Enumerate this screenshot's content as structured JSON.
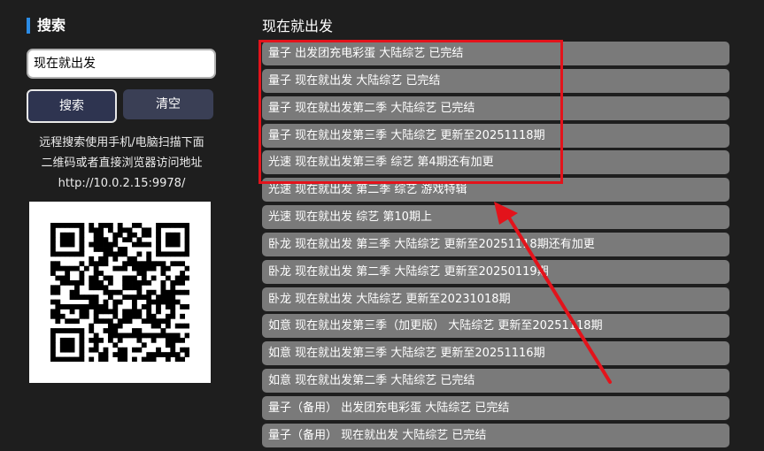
{
  "sidebar": {
    "title": "搜索",
    "search_value": "现在就出发",
    "search_button": "搜索",
    "clear_button": "清空",
    "hint_lines": [
      "远程搜索使用手机/电脑扫描下面",
      "二维码或者直接浏览器访问地址",
      "http://10.0.2.15:9978/"
    ]
  },
  "results": {
    "title": "现在就出发",
    "items": [
      "量子 出发团充电彩蛋 大陆综艺 已完结",
      "量子 现在就出发 大陆综艺 已完结",
      "量子 现在就出发第二季 大陆综艺 已完结",
      "量子 现在就出发第三季 大陆综艺 更新至20251118期",
      "光速 现在就出发第三季 综艺 第4期还有加更",
      "光速 现在就出发 第二季 综艺 游戏特辑",
      "光速 现在就出发 综艺 第10期上",
      "卧龙 现在就出发 第三季 大陆综艺 更新至20251118期还有加更",
      "卧龙 现在就出发 第二季 大陆综艺 更新至20250119期",
      "卧龙 现在就出发 大陆综艺 更新至20231018期",
      "如意 现在就出发第三季（加更版） 大陆综艺 更新至20251118期",
      "如意 现在就出发第三季 大陆综艺 更新至20251116期",
      "如意 现在就出发第二季 大陆综艺 已完结",
      "量子（备用） 出发团充电彩蛋 大陆综艺 已完结",
      "量子（备用） 现在就出发 大陆综艺 已完结"
    ]
  },
  "colors": {
    "accent": "#2b8ce6",
    "highlight": "#e3131b",
    "row_bg": "#7a7a7a",
    "bg": "#1e1e1e"
  }
}
